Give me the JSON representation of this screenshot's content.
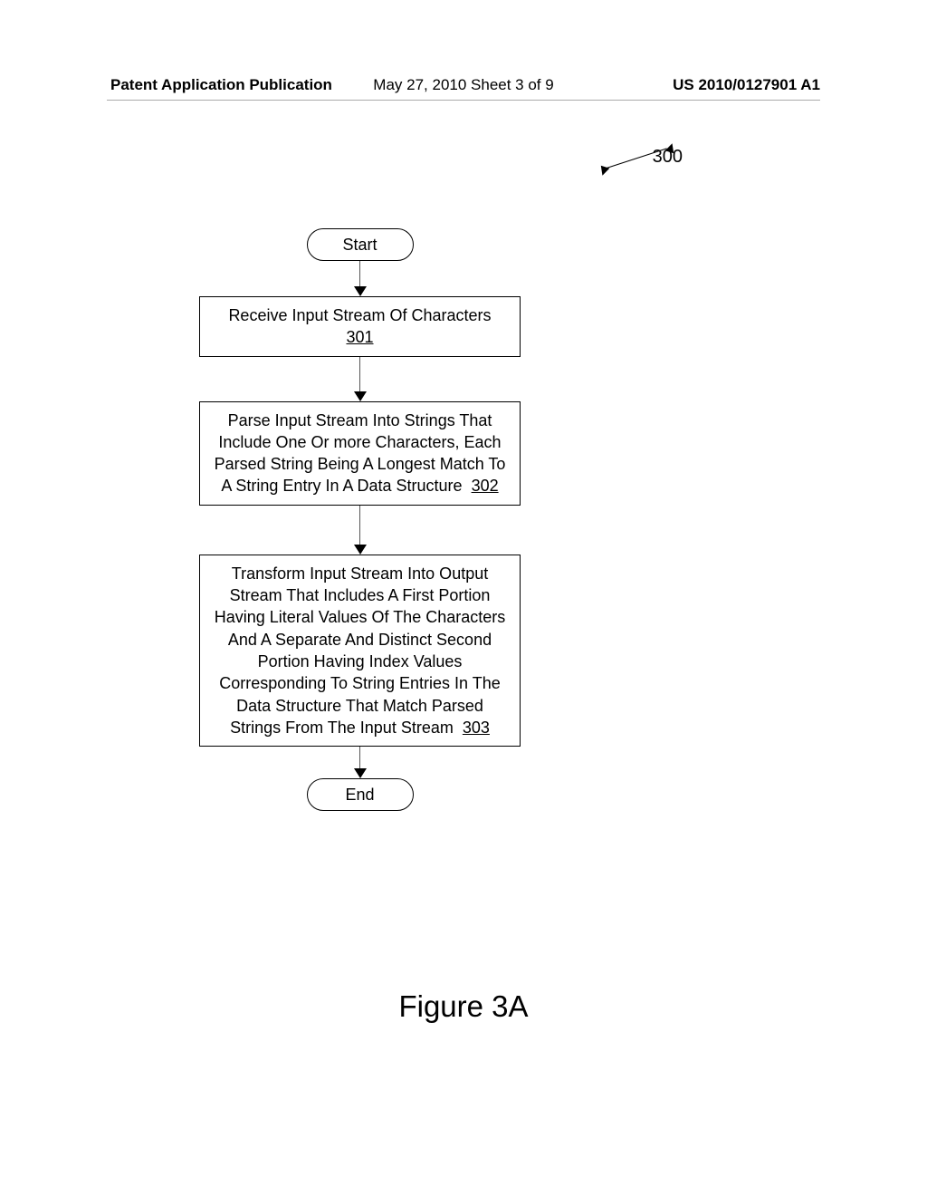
{
  "header": {
    "left": "Patent Application Publication",
    "center": "May 27, 2010  Sheet 3 of 9",
    "right": "US 2010/0127901 A1"
  },
  "reference_number": "300",
  "flowchart": {
    "start_label": "Start",
    "end_label": "End",
    "steps": [
      {
        "text": "Receive Input Stream Of Characters",
        "number": "301"
      },
      {
        "text": "Parse Input Stream Into Strings That Include One Or more Characters, Each Parsed String Being A Longest Match To A String Entry In A Data Structure",
        "number": "302"
      },
      {
        "text": "Transform Input Stream Into Output Stream That Includes A First Portion Having Literal Values Of The Characters And A Separate And Distinct Second Portion Having Index Values Corresponding To String Entries In The Data Structure That Match Parsed Strings From The Input Stream",
        "number": "303"
      }
    ]
  },
  "figure_caption": "Figure 3A"
}
